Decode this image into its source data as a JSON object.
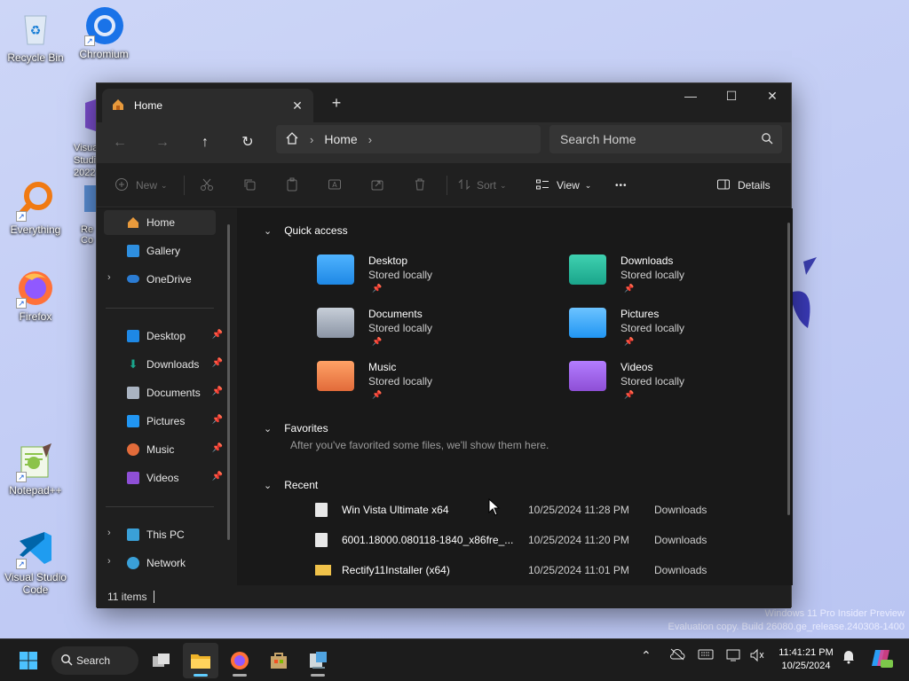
{
  "desktop": {
    "icons": [
      {
        "label": "Recycle Bin",
        "icon": "recycle-bin-icon"
      },
      {
        "label": "Chromium",
        "icon": "chromium-icon"
      },
      {
        "label": "Visual Studio 2022",
        "icon": "visual-studio-icon"
      },
      {
        "label": "Everything",
        "icon": "everything-search-icon"
      },
      {
        "label": "Re Co",
        "icon": "app-icon"
      },
      {
        "label": "Firefox",
        "icon": "firefox-icon"
      },
      {
        "label": "Notepad++",
        "icon": "notepad-plus-plus-icon"
      },
      {
        "label": "Visual Studio Code",
        "icon": "vscode-icon"
      }
    ],
    "watermark_line1": "Windows 11 Pro Insider Preview",
    "watermark_line2": "Evaluation copy. Build 26080.ge_release.240308-1400"
  },
  "window": {
    "tab_title": "Home",
    "tab_close": "✕",
    "new_tab": "+",
    "controls": {
      "minimize": "—",
      "maximize": "☐",
      "close": "✕"
    },
    "nav": {
      "back": "←",
      "forward": "→",
      "up": "↑",
      "refresh": "↻",
      "breadcrumb": "Home",
      "search_placeholder": "Search Home"
    },
    "commands": {
      "new": "New",
      "sort": "Sort",
      "view": "View",
      "more": "•••",
      "details": "Details"
    },
    "sidebar": {
      "top": [
        {
          "label": "Home",
          "selected": true
        },
        {
          "label": "Gallery"
        },
        {
          "label": "OneDrive",
          "expandable": true
        }
      ],
      "pinned": [
        {
          "label": "Desktop"
        },
        {
          "label": "Downloads"
        },
        {
          "label": "Documents"
        },
        {
          "label": "Pictures"
        },
        {
          "label": "Music"
        },
        {
          "label": "Videos"
        }
      ],
      "bottom": [
        {
          "label": "This PC"
        },
        {
          "label": "Network"
        }
      ]
    },
    "sections": {
      "quick_access": "Quick access",
      "favorites": "Favorites",
      "favorites_empty": "After you've favorited some files, we'll show them here.",
      "recent": "Recent"
    },
    "quick_access": [
      {
        "name": "Desktop",
        "sub": "Stored locally",
        "color": "#1e88e5"
      },
      {
        "name": "Downloads",
        "sub": "Stored locally",
        "color": "#1aa58b"
      },
      {
        "name": "Documents",
        "sub": "Stored locally",
        "color": "#8b95a5"
      },
      {
        "name": "Pictures",
        "sub": "Stored locally",
        "color": "#2196f3"
      },
      {
        "name": "Music",
        "sub": "Stored locally",
        "color": "#e26b3a"
      },
      {
        "name": "Videos",
        "sub": "Stored locally",
        "color": "#8e4fd6"
      }
    ],
    "recent": [
      {
        "name": "Win Vista Ultimate x64",
        "date": "10/25/2024 11:28 PM",
        "location": "Downloads"
      },
      {
        "name": "6001.18000.080118-1840_x86fre_...",
        "date": "10/25/2024 11:20 PM",
        "location": "Downloads"
      },
      {
        "name": "Rectify11Installer (x64)",
        "date": "10/25/2024 11:01 PM",
        "location": "Downloads"
      }
    ],
    "status": "11 items"
  },
  "taskbar": {
    "search_label": "Search",
    "time": "11:41:21 PM",
    "date": "10/25/2024"
  }
}
